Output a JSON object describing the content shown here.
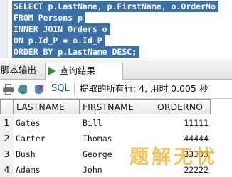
{
  "editor": {
    "lines": [
      "SELECT p.LastName, p.FirstName, o.OrderNo",
      "FROM Persons p",
      "INNER JOIN Orders o",
      "ON p.Id_P = o.Id_P",
      "ORDER BY p.LastName DESC;"
    ]
  },
  "tabs": {
    "script_output": "脚本输出",
    "query_result": "查询结果"
  },
  "toolbar": {
    "sql_label": "SQL",
    "status": "提取的所有行: 4, 用时 0.005 秒"
  },
  "grid": {
    "columns": [
      "LASTNAME",
      "FIRSTNAME",
      "ORDERNO"
    ],
    "rows": [
      {
        "num": "1",
        "lastname": "Gates",
        "firstname": "Bill",
        "orderno": "11111"
      },
      {
        "num": "2",
        "lastname": "Carter",
        "firstname": "Thomas",
        "orderno": "44444"
      },
      {
        "num": "3",
        "lastname": "Bush",
        "firstname": "George",
        "orderno": "33333"
      },
      {
        "num": "4",
        "lastname": "Adams",
        "firstname": "John",
        "orderno": "22222"
      }
    ]
  },
  "watermark": "题解无忧",
  "colors": {
    "selection": "#3b6fa7",
    "run_icon": "#2e8b2e",
    "sql_link": "#1a55a0",
    "watermark": "#f1b12e"
  }
}
